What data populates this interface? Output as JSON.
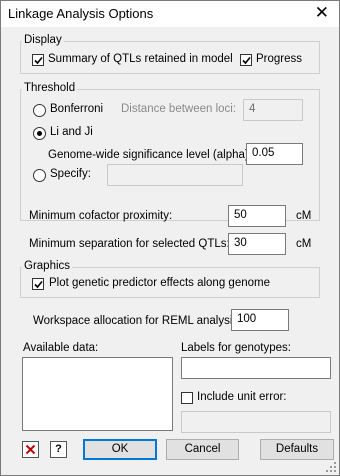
{
  "window": {
    "title": "Linkage Analysis Options"
  },
  "display": {
    "group_title": "Display",
    "summary_label": "Summary of QTLs retained in model",
    "summary_checked": true,
    "progress_label": "Progress",
    "progress_checked": true
  },
  "threshold": {
    "group_title": "Threshold",
    "bonferroni_label": "Bonferroni",
    "distance_label": "Distance between loci:",
    "distance_value": "4",
    "liji_label": "Li and Ji",
    "selected": "Li and Ji",
    "alpha_label": "Genome-wide significance level (alpha):",
    "alpha_value": "0.05",
    "specify_label": "Specify:",
    "specify_value": ""
  },
  "cofactor": {
    "label": "Minimum cofactor proximity:",
    "value": "50",
    "unit": "cM"
  },
  "separation": {
    "label": "Minimum separation for selected QTLs:",
    "value": "30",
    "unit": "cM"
  },
  "graphics": {
    "group_title": "Graphics",
    "plot_label": "Plot genetic predictor effects along genome",
    "plot_checked": true
  },
  "workspace": {
    "label": "Workspace allocation for REML analysis:",
    "value": "100"
  },
  "available_data": {
    "label": "Available data:"
  },
  "genotypes": {
    "label": "Labels for genotypes:",
    "value": ""
  },
  "unit_error": {
    "label": "Include unit error:",
    "checked": false,
    "value": ""
  },
  "buttons": {
    "cancel_icon": "x-icon",
    "help_icon": "help-icon",
    "help_glyph": "?",
    "ok": "OK",
    "cancel": "Cancel",
    "defaults": "Defaults"
  },
  "colors": {
    "accent": "#0078d7",
    "cancel_icon": "#c00000"
  }
}
